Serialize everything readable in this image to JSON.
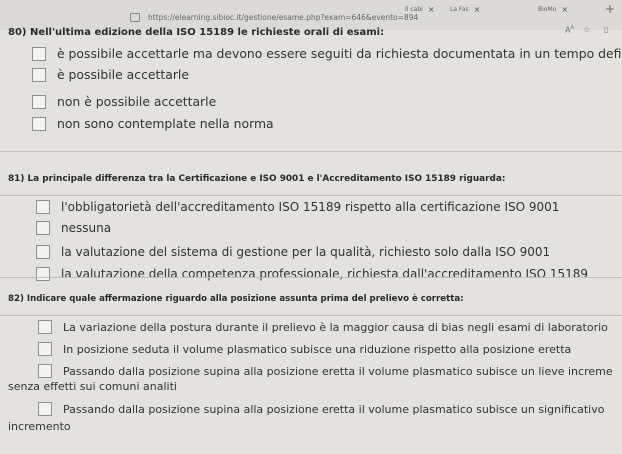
{
  "browser": {
    "url": "https://elearning.sibioc.it/gestione/esame.php?exam=646&evento=894",
    "tabs": [
      {
        "label": "Il cabi",
        "close": "×"
      },
      {
        "label": "La Fas",
        "close": "×"
      },
      {
        "label": "BioMo",
        "close": "×"
      }
    ],
    "new_tab": "+"
  },
  "questions": [
    {
      "title": "80) Nell'ultima edizione della ISO 15189 le richieste orali di esami:",
      "options": [
        "è possibile accettarle ma devono essere seguiti da richiesta documentata in un tempo defini",
        "è possibile accettarle",
        "non è possibile accettarle",
        "non sono contemplate nella norma"
      ]
    },
    {
      "title": "81) La principale differenza tra la Certificazione e ISO 9001 e l'Accreditamento ISO 15189 riguarda:",
      "options": [
        "l'obbligatorietà dell'accreditamento ISO 15189 rispetto alla certificazione ISO 9001",
        "nessuna",
        "la valutazione del sistema di gestione per la qualità, richiesto solo dalla ISO 9001",
        "la valutazione della competenza professionale, richiesta dall'accreditamento ISO 15189"
      ]
    },
    {
      "title": "82) Indicare quale affermazione riguardo alla posizione assunta prima del prelievo è corretta:",
      "options": [
        "La variazione della postura durante il prelievo è la maggior causa di bias negli esami di laboratorio",
        "In posizione seduta il volume plasmatico subisce una riduzione rispetto alla posizione eretta",
        "Passando dalla posizione supina alla posizione eretta il volume plasmatico subisce un lieve increme",
        "Passando dalla posizione supina alla posizione eretta il volume plasmatico subisce un significativo"
      ],
      "wrapped": [
        "senza effetti sui comuni analiti",
        "incremento"
      ]
    }
  ]
}
